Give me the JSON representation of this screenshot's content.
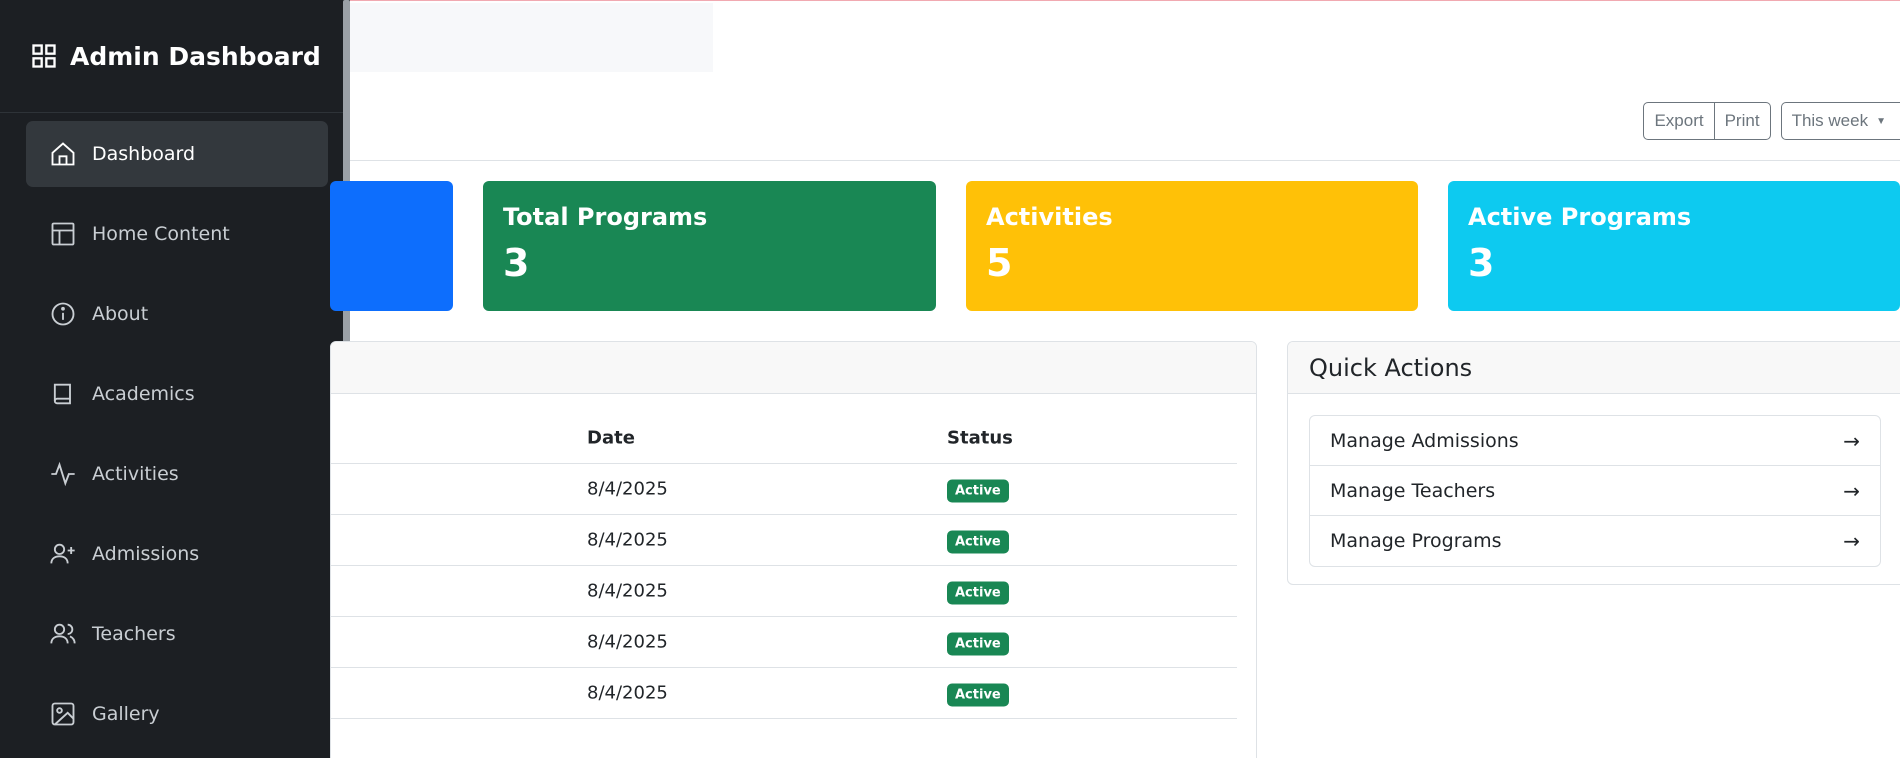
{
  "sidebar": {
    "title": "Admin Dashboard",
    "items": [
      {
        "label": "Dashboard",
        "icon": "home-icon",
        "active": true
      },
      {
        "label": "Home Content",
        "icon": "layout-icon"
      },
      {
        "label": "About",
        "icon": "info-icon"
      },
      {
        "label": "Academics",
        "icon": "book-icon"
      },
      {
        "label": "Activities",
        "icon": "activity-icon"
      },
      {
        "label": "Admissions",
        "icon": "user-plus-icon"
      },
      {
        "label": "Teachers",
        "icon": "users-icon"
      },
      {
        "label": "Gallery",
        "icon": "image-icon"
      }
    ]
  },
  "toolbar": {
    "export_label": "Export",
    "print_label": "Print",
    "range_label": "This week"
  },
  "stats": [
    {
      "title": "",
      "value": "",
      "color": "#0d6efd"
    },
    {
      "title": "Total Programs",
      "value": "3",
      "color": "#198754"
    },
    {
      "title": "Activities",
      "value": "5",
      "color": "#ffc107"
    },
    {
      "title": "Active Programs",
      "value": "3",
      "color": "#0dcaf0"
    }
  ],
  "table": {
    "headers": {
      "date": "Date",
      "status": "Status"
    },
    "rows": [
      {
        "date": "8/4/2025",
        "status": "Active"
      },
      {
        "date": "8/4/2025",
        "status": "Active"
      },
      {
        "date": "8/4/2025",
        "status": "Active"
      },
      {
        "date": "8/4/2025",
        "status": "Active"
      },
      {
        "date": "8/4/2025",
        "status": "Active"
      }
    ]
  },
  "quick_actions": {
    "title": "Quick Actions",
    "items": [
      {
        "label": "Manage Admissions",
        "arrow": "→"
      },
      {
        "label": "Manage Teachers",
        "arrow": "→"
      },
      {
        "label": "Manage Programs",
        "arrow": "→"
      }
    ]
  }
}
